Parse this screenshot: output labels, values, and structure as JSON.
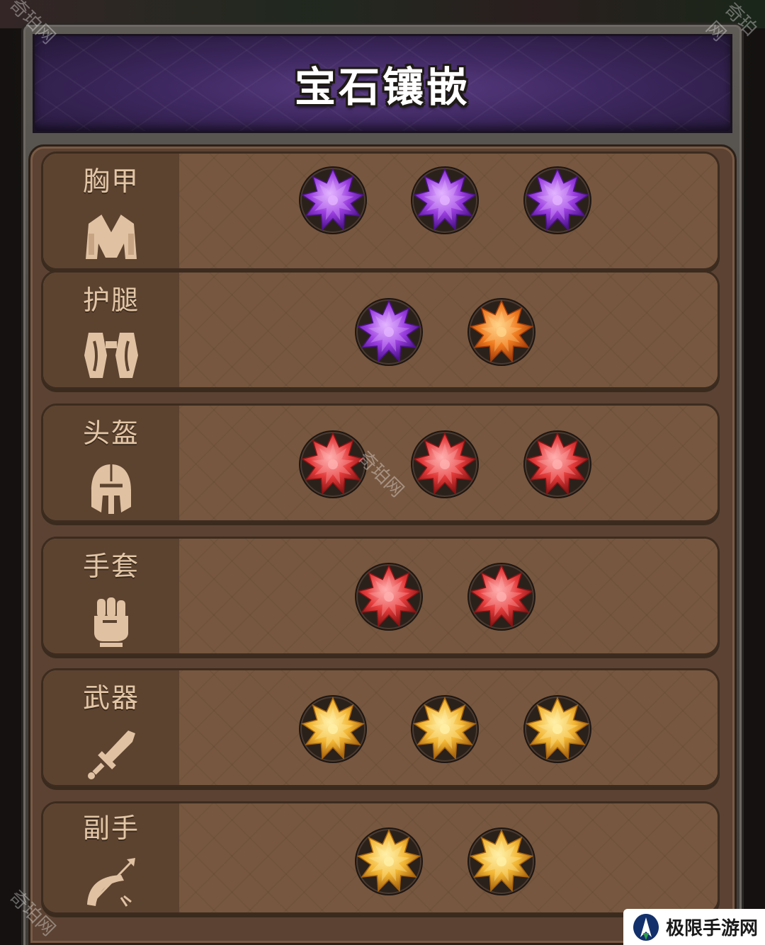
{
  "header": {
    "title": "宝石镶嵌"
  },
  "rows": [
    {
      "label": "胸甲",
      "icon": "chest-armor-icon",
      "gems": [
        "purple",
        "purple",
        "purple"
      ]
    },
    {
      "label": "护腿",
      "icon": "leg-guard-icon",
      "gems": [
        "purple",
        "orange"
      ]
    },
    {
      "label": "头盔",
      "icon": "helmet-icon",
      "gems": [
        "red",
        "red",
        "red"
      ]
    },
    {
      "label": "手套",
      "icon": "gauntlet-fist-icon",
      "gems": [
        "red",
        "red"
      ]
    },
    {
      "label": "武器",
      "icon": "sword-icon",
      "gems": [
        "gold",
        "gold",
        "gold"
      ]
    },
    {
      "label": "副手",
      "icon": "bow-icon",
      "gems": [
        "gold",
        "gold"
      ]
    }
  ],
  "gem_colors": {
    "purple": {
      "light": "#e3b4ff",
      "mid": "#9a3de0",
      "dark": "#4c138a"
    },
    "orange": {
      "light": "#ffd38a",
      "mid": "#f07a1e",
      "dark": "#a23c0a"
    },
    "red": {
      "light": "#ffb0b0",
      "mid": "#e43a3a",
      "dark": "#8a1414"
    },
    "gold": {
      "light": "#fff0a8",
      "mid": "#f2b532",
      "dark": "#a8640e"
    }
  },
  "watermark": {
    "text": "奇珀网",
    "logo_text": "极限手游网"
  }
}
